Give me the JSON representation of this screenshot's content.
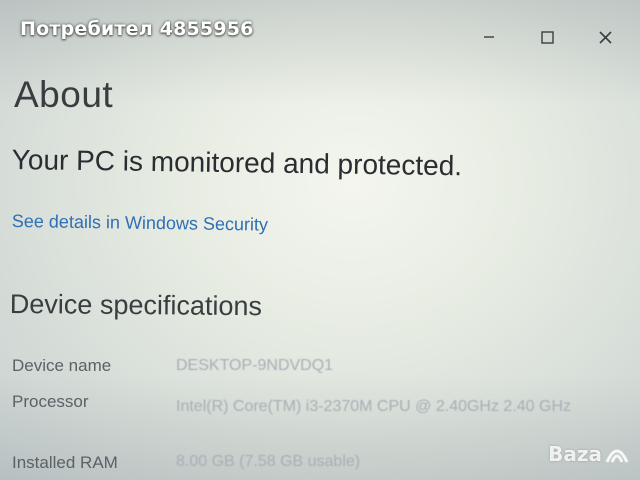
{
  "overlay": {
    "seller_title": "Потребител 4855956"
  },
  "window": {
    "controls": [
      {
        "name": "minimize-button",
        "icon": "minimize-icon"
      },
      {
        "name": "maximize-button",
        "icon": "maximize-icon"
      },
      {
        "name": "close-button",
        "icon": "close-icon"
      }
    ]
  },
  "about": {
    "title": "About",
    "protection_message": "Your PC is monitored and protected.",
    "security_link": "See details in Windows Security"
  },
  "device_specs": {
    "title": "Device specifications",
    "rows": [
      {
        "label": "Device name",
        "value": "DESKTOP-9NDVDQ1"
      },
      {
        "label": "Processor",
        "value": "Intel(R) Core(TM) i3-2370M CPU @ 2.40GHz   2.40 GHz"
      },
      {
        "label": "Installed RAM",
        "value": "8.00 GB (7.58 GB usable)"
      }
    ]
  },
  "watermark": {
    "text": "Baza"
  },
  "colors": {
    "link": "#2f6fb3",
    "background": "#e6ebe2",
    "overlay_text": "#ffffff"
  }
}
